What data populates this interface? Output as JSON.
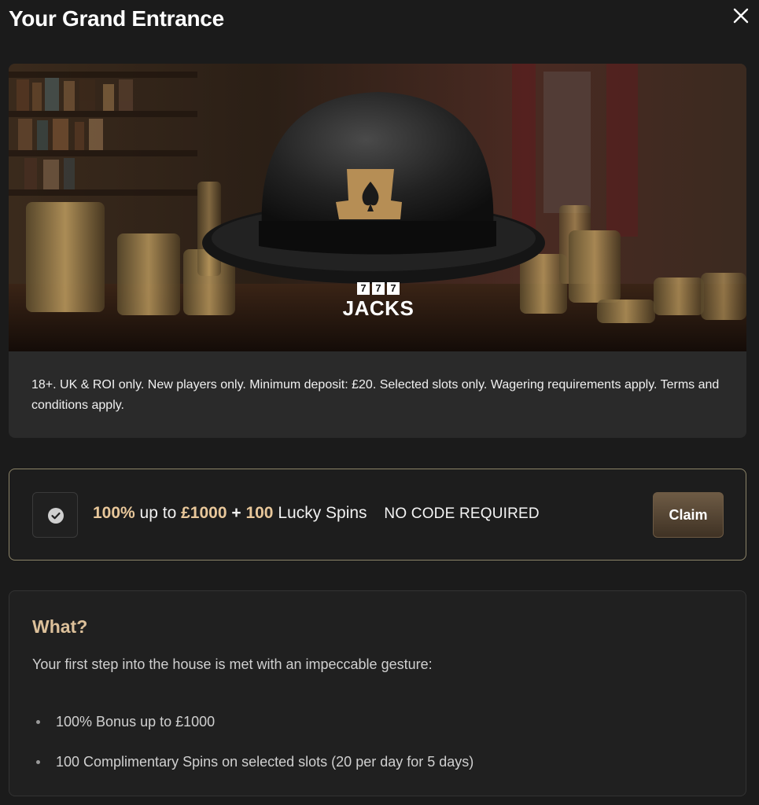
{
  "modal": {
    "title": "Your Grand Entrance",
    "close_icon": "close-icon"
  },
  "hero": {
    "image_description_icon": "bowler-hat-image",
    "logo": {
      "digits": [
        "7",
        "7",
        "7"
      ],
      "word": "JACKS"
    },
    "disclaimer": "18+. UK & ROI only. New players only. Minimum deposit: £20. Selected slots only. Wagering requirements apply. Terms and conditions apply."
  },
  "offer": {
    "check_icon": "check-circle-icon",
    "percent": "100%",
    "up_to": " up to ",
    "amount": "£1000",
    "plus": " + ",
    "spins_count": "100",
    "spins_label": " Lucky Spins",
    "code_text": "NO CODE REQUIRED",
    "claim_label": "Claim"
  },
  "what": {
    "heading": "What?",
    "intro": "Your first step into the house is met with an impeccable gesture:",
    "items": [
      "100% Bonus up to £1000",
      "100 Complimentary Spins on selected slots (20 per day for 5 days)"
    ]
  },
  "colors": {
    "background": "#1b1b1b",
    "accent_gold": "#e8c79a",
    "heading_gold": "#dcc09a",
    "claim_button": "#5a4835",
    "offer_border": "#8c8468"
  }
}
